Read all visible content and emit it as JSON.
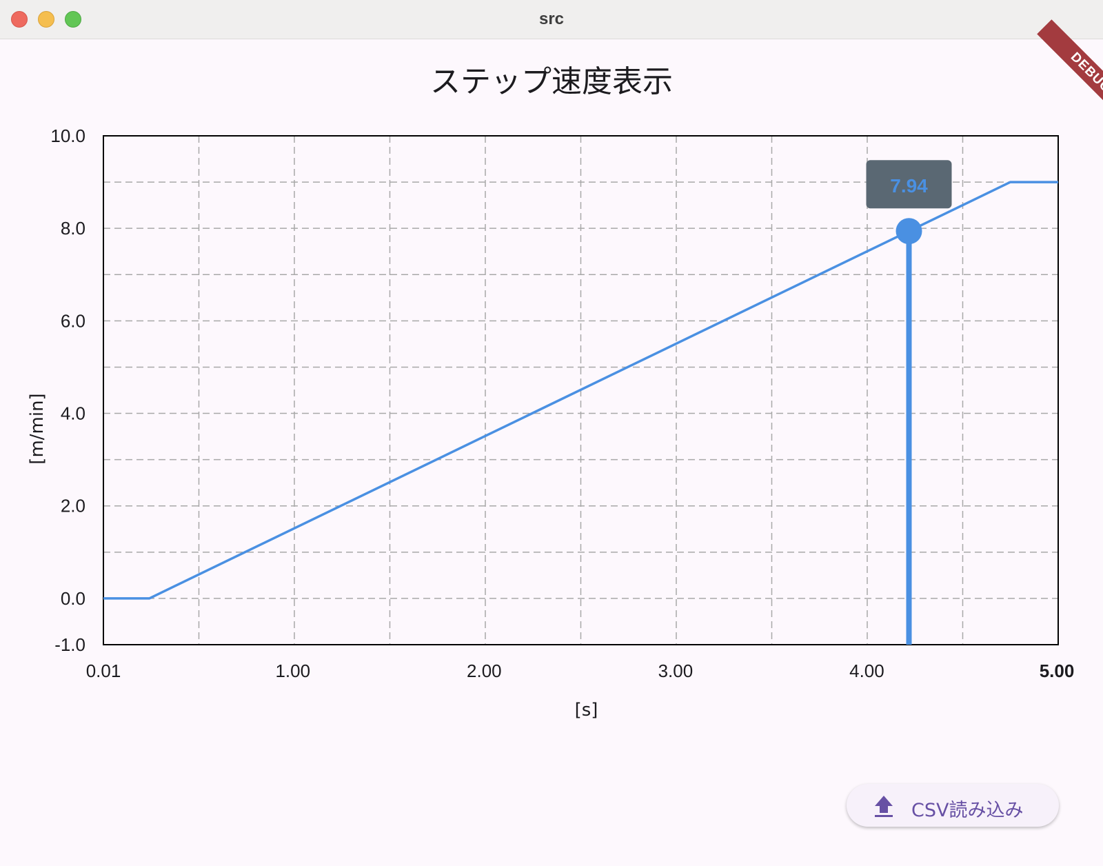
{
  "window": {
    "title": "src"
  },
  "page": {
    "title": "ステップ速度表示",
    "debug_badge": "DEBUG"
  },
  "chart_data": {
    "type": "line",
    "title": "",
    "xlabel": "[s]",
    "ylabel": "[m/min]",
    "xlim": [
      0.01,
      5.0
    ],
    "ylim": [
      -1.0,
      10.0
    ],
    "x_ticks": [
      "0.01",
      "1.00",
      "2.00",
      "3.00",
      "4.00",
      "5.00"
    ],
    "y_ticks": [
      "10.0",
      "8.0",
      "6.0",
      "4.0",
      "2.0",
      "0.0",
      "-1.0"
    ],
    "grid": true,
    "series": [
      {
        "color": "#4a90e2",
        "x": [
          0.01,
          0.25,
          4.75,
          5.0
        ],
        "y": [
          0.0,
          0.0,
          9.0,
          9.0
        ]
      }
    ],
    "highlight": {
      "x": 4.22,
      "value": 7.94,
      "label": "7.94"
    }
  },
  "actions": {
    "upload_csv_label": "CSV読み込み",
    "upload_icon": "upload-icon"
  },
  "colors": {
    "line": "#4a90e2",
    "tooltip_bg": "#5a6873",
    "accent": "#6750a4"
  }
}
